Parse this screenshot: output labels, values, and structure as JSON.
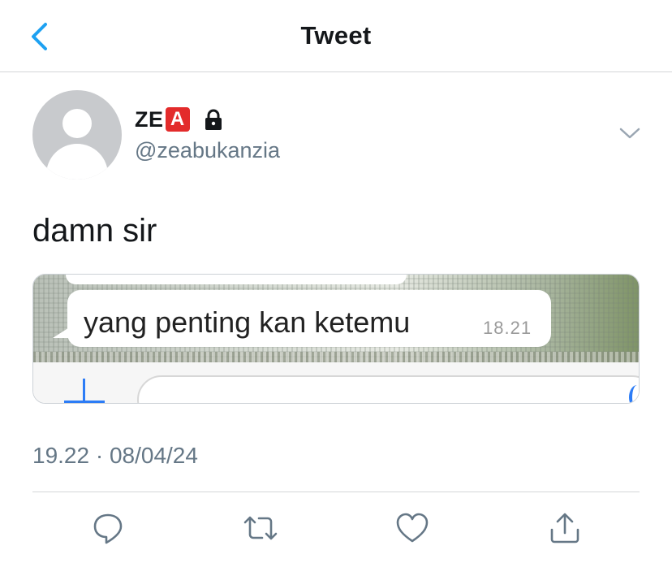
{
  "nav": {
    "title": "Tweet"
  },
  "author": {
    "name": "ZE",
    "badge": "A",
    "handle": "@zeabukanzia"
  },
  "tweet": {
    "text": "damn sir",
    "timestamp": "19.22 · 08/04/24"
  },
  "media": {
    "message_text": "yang penting kan ketemu",
    "message_time": "18.21"
  },
  "colors": {
    "accent": "#1da1f2",
    "secondary_text": "#657786",
    "divider": "#d4d6d8"
  },
  "icons": [
    "back-chevron-icon",
    "lock-icon",
    "chevron-down-icon",
    "reply-icon",
    "retweet-icon",
    "like-icon",
    "share-icon"
  ]
}
